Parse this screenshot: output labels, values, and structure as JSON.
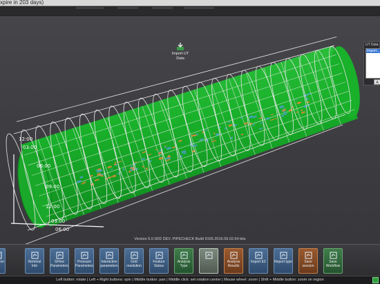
{
  "app": {
    "title_fragment": "xpire in 203 days)"
  },
  "colors": {
    "pipe": "#19b02a",
    "wireframe": "#e8e8e8",
    "viewport_bg": "#424246",
    "defect_warm": "#d98a3a",
    "defect_cool": "#4aa0c8"
  },
  "viewport": {
    "clock_labels": [
      "12:00",
      "03:00",
      "06:00",
      "09:00"
    ],
    "import_button": {
      "label": "Import UT Data",
      "icon": "import-arrow-icon"
    }
  },
  "ut_panel": {
    "title": "UT Data",
    "list_item": "Import...",
    "button_label": "A"
  },
  "version_text": "Version 5.0.SR2 DEV, PIPECHECK Build 9165.2016.09.02.64 bits",
  "toolbar": [
    {
      "label": "Position",
      "icon": "position-icon",
      "color": "blue"
    },
    {
      "label": "Nominal Info",
      "icon": "nominal-icon",
      "color": "blue"
    },
    {
      "label": "SFlow Parameters",
      "icon": "sflow-icon",
      "color": "blue"
    },
    {
      "label": "Pressure Parameters",
      "icon": "pressure-icon",
      "color": "blue"
    },
    {
      "label": "Interaction parameters",
      "icon": "interaction-icon",
      "color": "blue"
    },
    {
      "label": "Grid resolution",
      "icon": "grid-icon",
      "color": "blue"
    },
    {
      "label": "Feature Status",
      "icon": "feature-icon",
      "color": "blue"
    },
    {
      "label": "Analysis Type",
      "icon": "analysis-type-icon",
      "color": "green"
    },
    {
      "label": "",
      "icon": "import-ut-data-icon",
      "color": "active"
    },
    {
      "label": "Analysis Results",
      "icon": "analysis-results-icon",
      "color": "orange"
    },
    {
      "label": "Import EZ",
      "icon": "import-ez-icon",
      "color": "blue"
    },
    {
      "label": "Report type",
      "icon": "report-icon",
      "color": "blue"
    },
    {
      "label": "Save session",
      "icon": "save-session-icon",
      "color": "orange"
    },
    {
      "label": "Save Workflow",
      "icon": "save-workflow-icon",
      "color": "green"
    }
  ],
  "status_text": "Left button: rotate | Left + Right buttons: spin | Middle button: pan | Middle click: set rotation center | Mouse wheel: zoom | Shift + Middle button: zoom on region"
}
